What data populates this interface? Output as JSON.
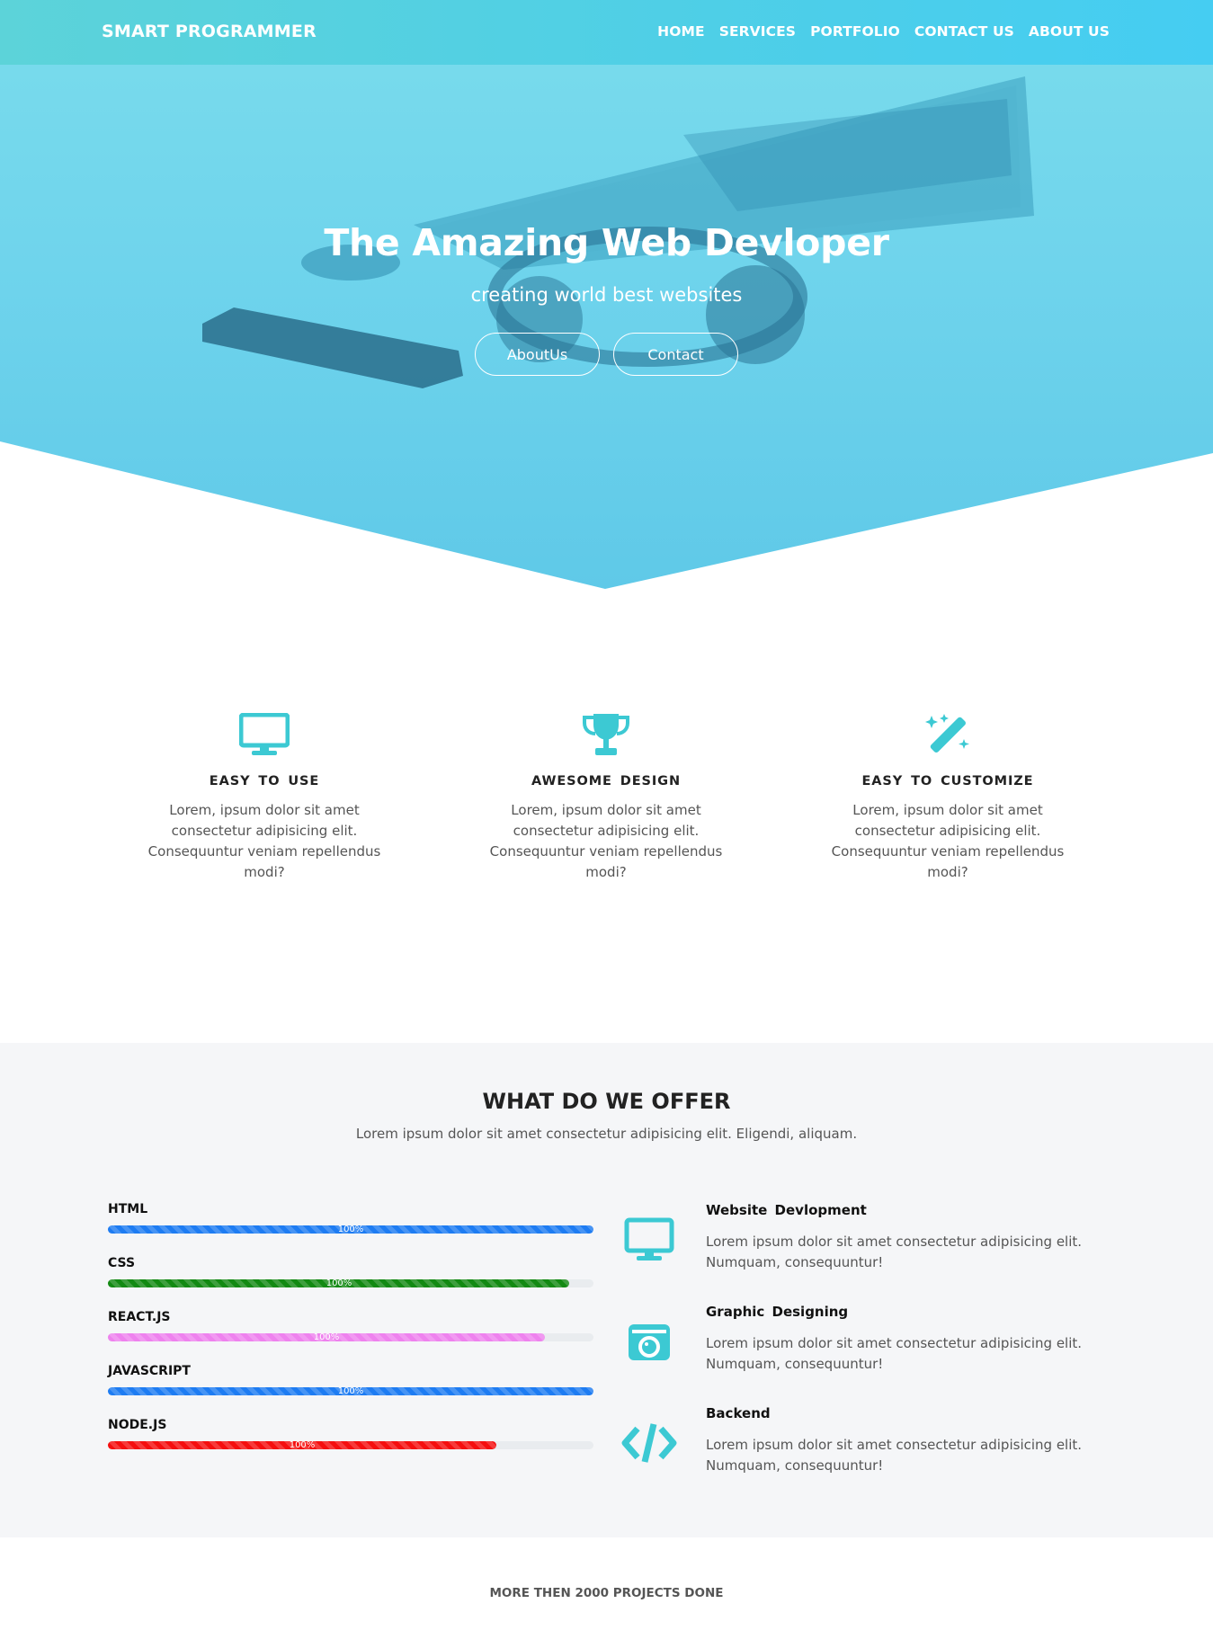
{
  "nav": {
    "brand": "SMART PROGRAMMER",
    "links": [
      "HOME",
      "SERVICES",
      "PORTFOLIO",
      "CONTACT US",
      "ABOUT US"
    ]
  },
  "hero": {
    "title": "The Amazing Web Devloper",
    "subtitle": "creating world best websites",
    "buttons": [
      "AboutUs",
      "Contact"
    ]
  },
  "features": [
    {
      "icon": "desktop-icon",
      "title": "EASY TO USE",
      "text": "Lorem, ipsum dolor sit amet consectetur adipisicing elit. Consequuntur veniam repellendus modi?"
    },
    {
      "icon": "trophy-icon",
      "title": "AWESOME DESIGN",
      "text": "Lorem, ipsum dolor sit amet consectetur adipisicing elit. Consequuntur veniam repellendus modi?"
    },
    {
      "icon": "magic-wand-icon",
      "title": "EASY TO CUSTOMIZE",
      "text": "Lorem, ipsum dolor sit amet consectetur adipisicing elit. Consequuntur veniam repellendus modi?"
    }
  ],
  "offer": {
    "title": "WHAT DO WE OFFER",
    "lead": "Lorem ipsum dolor sit amet consectetur adipisicing elit. Eligendi, aliquam.",
    "skills": [
      {
        "name": "HTML",
        "label": "100%",
        "level": 1.0,
        "color": "#1e7cf2"
      },
      {
        "name": "CSS",
        "label": "100%",
        "level": 0.95,
        "color": "#138a13"
      },
      {
        "name": "REACT.JS",
        "label": "100%",
        "level": 0.9,
        "color": "#ee82ee"
      },
      {
        "name": "JAVASCRIPT",
        "label": "100%",
        "level": 1.0,
        "color": "#1e7cf2"
      },
      {
        "name": "NODE.JS",
        "label": "100%",
        "level": 0.8,
        "color": "#f50f0f"
      }
    ],
    "services": [
      {
        "icon": "desktop-icon",
        "title": "Website Devlopment",
        "text": "Lorem ipsum dolor sit amet consectetur adipisicing elit. Numquam, consequuntur!"
      },
      {
        "icon": "camera-icon",
        "title": "Graphic Designing",
        "text": "Lorem ipsum dolor sit amet consectetur adipisicing elit. Numquam, consequuntur!"
      },
      {
        "icon": "code-icon",
        "title": "Backend",
        "text": "Lorem ipsum dolor sit amet consectetur adipisicing elit. Numquam, consequuntur!"
      }
    ]
  },
  "projects": {
    "title": "MORE THEN 2000 PROJECTS DONE"
  },
  "colors": {
    "accent": "#3cc9d3",
    "hero_top": "#7adcec",
    "hero_bottom": "#5fc9e8"
  }
}
